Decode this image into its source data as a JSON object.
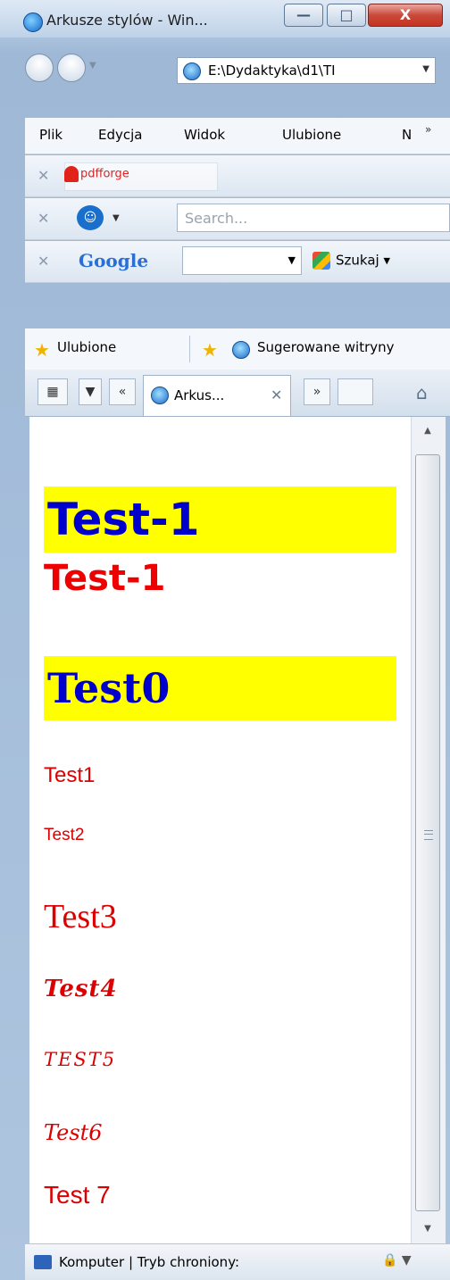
{
  "window": {
    "title": "Arkusze stylów - Win...",
    "min_glyph": "—",
    "max_glyph": "□",
    "close_glyph": "X"
  },
  "address": {
    "value": "E:\\Dydaktyka\\d1\\TI"
  },
  "menu": {
    "items": [
      "Plik",
      "Edycja",
      "Widok",
      "Ulubione",
      "N"
    ],
    "more": "»"
  },
  "toolbars": {
    "pdfforge_label": "pdfforge",
    "search_placeholder": "Search...",
    "google_logo": "Google",
    "google_search_button": "Szukaj"
  },
  "favorites": {
    "favorites_label": "Ulubione",
    "suggested_label": "Sugerowane witryny"
  },
  "tabs": {
    "active_label": "Arkus...",
    "close_glyph": "✕",
    "back_glyph": "«",
    "more_glyph": "»"
  },
  "content": {
    "lines": [
      "Test-1",
      "Test-1",
      "Test0",
      "Test1",
      "Test2",
      "Test3",
      "Test4",
      "TEST5",
      "Test6",
      "Test 7"
    ]
  },
  "statusbar": {
    "text": "Komputer | Tryb chroniony:"
  },
  "colors": {
    "highlight": "#ffff00",
    "heading_blue": "#0000cc",
    "text_red": "#dd0000"
  }
}
